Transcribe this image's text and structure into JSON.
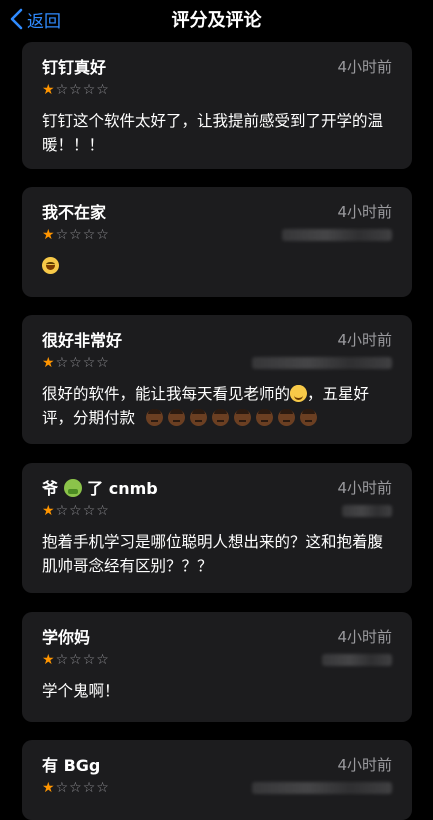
{
  "nav": {
    "back_label": "返回",
    "title": "评分及评论"
  },
  "reviews": [
    {
      "title": "钉钉真好",
      "time": "4小时前",
      "rating": 1,
      "body": "钉钉这个软件太好了，让我提前感受到了开学的温暖！！！"
    },
    {
      "title": "我不在家",
      "time": "4小时前",
      "rating": 1,
      "body": ""
    },
    {
      "title": "很好非常好",
      "time": "4小时前",
      "rating": 1,
      "body_before": "很好的软件，能让我每天看见老师的",
      "body_after": "，五星好评，分期付款"
    },
    {
      "title_pre": "爷",
      "title_post": "了 cnmb",
      "time": "4小时前",
      "rating": 1,
      "body": "抱着手机学习是哪位聪明人想出来的？这和抱着腹肌帅哥念经有区别？？？"
    },
    {
      "title": "学你妈",
      "time": "4小时前",
      "rating": 1,
      "body": "学个鬼啊！"
    },
    {
      "title": "有 BGg",
      "time": "4小时前",
      "rating": 1,
      "body": ""
    }
  ],
  "icons": {
    "back": "chevron-left-icon",
    "star_filled": "star-filled-icon",
    "star_empty": "star-empty-icon"
  },
  "colors": {
    "accent": "#2f8bff",
    "star": "#ff9500",
    "card": "#1c1c1e",
    "background": "#000000"
  }
}
